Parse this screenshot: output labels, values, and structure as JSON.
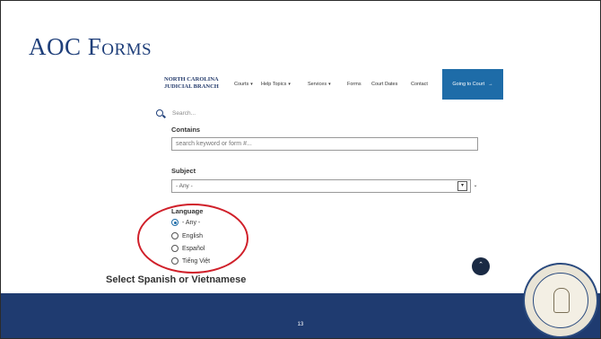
{
  "slide": {
    "title": "AOC Forms",
    "caption": "Select Spanish or Vietnamese",
    "page_number": "13"
  },
  "site_nav": {
    "logo_line1": "NORTH CAROLINA",
    "logo_line2": "JUDICIAL BRANCH",
    "items": [
      {
        "label": "Courts",
        "has_dropdown": true
      },
      {
        "label": "Help Topics",
        "has_dropdown": true
      },
      {
        "label": "Services",
        "has_dropdown": true
      },
      {
        "label": "Forms",
        "has_dropdown": false
      },
      {
        "label": "Court Dates",
        "has_dropdown": false
      },
      {
        "label": "Contact",
        "has_dropdown": false
      }
    ],
    "cta_label": "Going to Court",
    "cta_color": "#1e6ca8"
  },
  "search": {
    "placeholder": "Search..."
  },
  "form": {
    "contains_label": "Contains",
    "contains_placeholder": "search keyword or form #...",
    "subject_label": "Subject",
    "subject_value": "- Any -",
    "language_label": "Language",
    "language_options": [
      {
        "label": "- Any -",
        "checked": true
      },
      {
        "label": "English",
        "checked": false
      },
      {
        "label": "Español",
        "checked": false
      },
      {
        "label": "Tiếng Việt",
        "checked": false
      }
    ]
  },
  "colors": {
    "title": "#1f3f7a",
    "footer": "#1f3b70",
    "highlight": "#d0202a"
  }
}
